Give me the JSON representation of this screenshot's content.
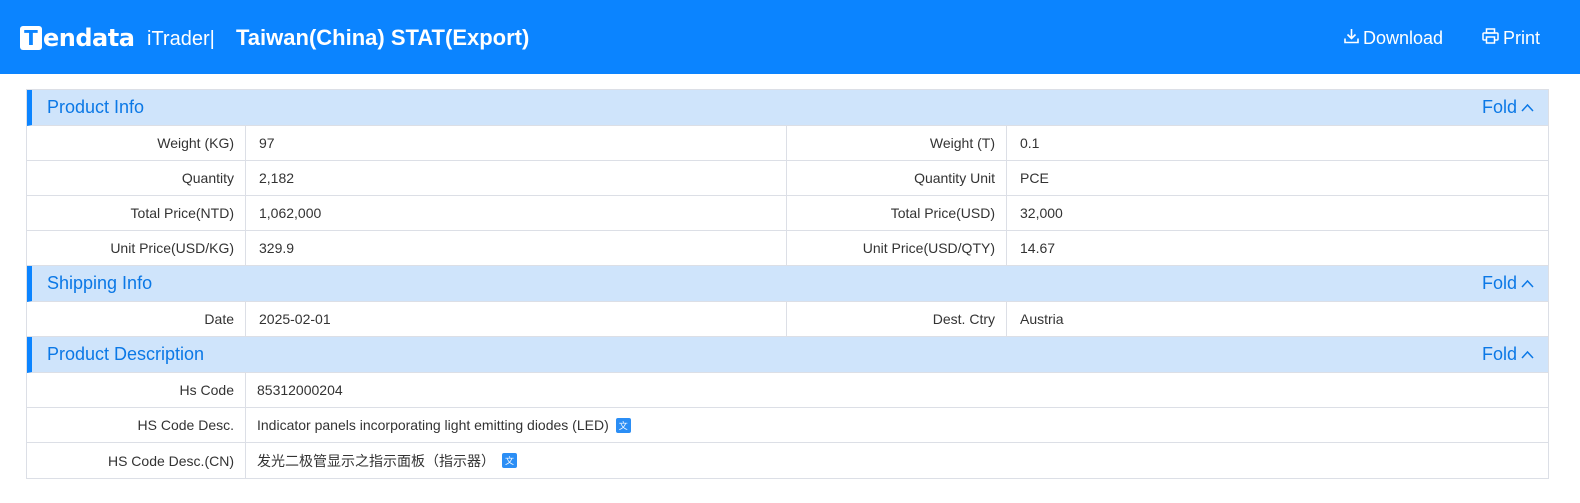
{
  "header": {
    "logo_mark": "T",
    "logo_text": "endata",
    "subbrand": "iTrader|",
    "title": "Taiwan(China) STAT(Export)",
    "download_label": "Download",
    "print_label": "Print",
    "bg_color": "#0b84ff"
  },
  "sections": {
    "product_info": {
      "title": "Product Info",
      "fold_label": "Fold",
      "rows": [
        {
          "l1": "Weight (KG)",
          "v1": "97",
          "l2": "Weight (T)",
          "v2": "0.1"
        },
        {
          "l1": "Quantity",
          "v1": "2,182",
          "l2": "Quantity Unit",
          "v2": "PCE"
        },
        {
          "l1": "Total Price(NTD)",
          "v1": "1,062,000",
          "l2": "Total Price(USD)",
          "v2": "32,000"
        },
        {
          "l1": "Unit Price(USD/KG)",
          "v1": "329.9",
          "l2": "Unit Price(USD/QTY)",
          "v2": "14.67"
        }
      ]
    },
    "shipping_info": {
      "title": "Shipping Info",
      "fold_label": "Fold",
      "rows": [
        {
          "l1": "Date",
          "v1": "2025-02-01",
          "l2": "Dest. Ctry",
          "v2": "Austria"
        }
      ]
    },
    "product_description": {
      "title": "Product Description",
      "fold_label": "Fold",
      "rows": [
        {
          "label": "Hs Code",
          "value": "85312000204"
        },
        {
          "label": "HS Code Desc.",
          "value": "Indicator panels incorporating light emitting diodes (LED)"
        },
        {
          "label": "HS Code Desc.(CN)",
          "value": "发光二极管显示之指示面板（指示器）"
        }
      ]
    }
  },
  "icons": {
    "download": "download-icon",
    "print": "printer-icon",
    "fold": "chevron-up-icon",
    "translate": "translate-icon"
  },
  "colors": {
    "accent": "#0b84ff",
    "section_bg": "#cfe4fb",
    "section_text": "#0b78e6",
    "border": "#dcdfe6"
  }
}
